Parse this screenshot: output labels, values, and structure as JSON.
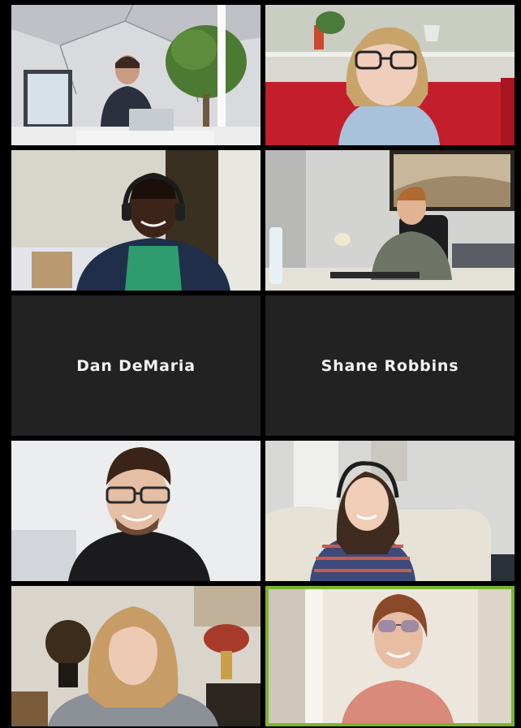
{
  "gallery": {
    "tiles": [
      {
        "id": "tile-1",
        "kind": "video"
      },
      {
        "id": "tile-2",
        "kind": "video"
      },
      {
        "id": "tile-3",
        "kind": "video"
      },
      {
        "id": "tile-4",
        "kind": "video"
      },
      {
        "id": "tile-5",
        "kind": "name",
        "name": "Dan DeMaria"
      },
      {
        "id": "tile-6",
        "kind": "name",
        "name": "Shane Robbins"
      },
      {
        "id": "tile-7",
        "kind": "video"
      },
      {
        "id": "tile-8",
        "kind": "video"
      },
      {
        "id": "tile-9",
        "kind": "video"
      },
      {
        "id": "tile-10",
        "kind": "video",
        "active_speaker": true
      }
    ]
  },
  "colors": {
    "background": "#000000",
    "name_tile_bg": "#222222",
    "name_text": "#f2f2f2",
    "active_speaker_border": "#7bb52c"
  }
}
